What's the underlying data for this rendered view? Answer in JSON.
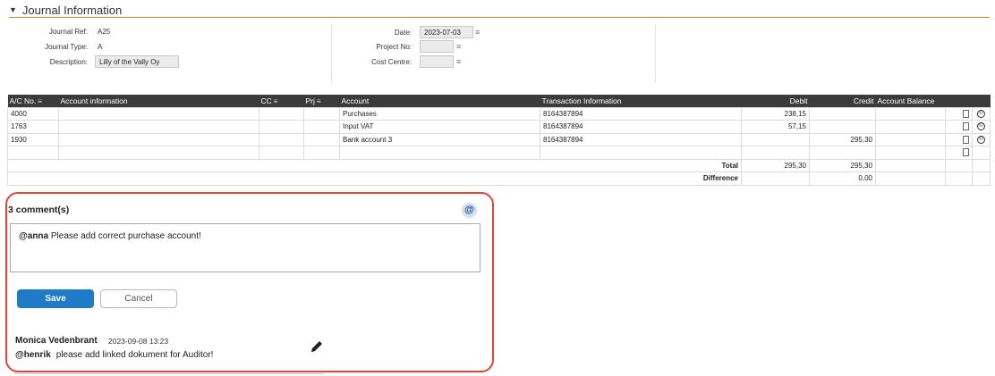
{
  "section": {
    "title": "Journal Information",
    "caret_icon": "caret-down-icon"
  },
  "journal": {
    "ref_label": "Journal Ref:",
    "ref_value": "A25",
    "type_label": "Journal Type:",
    "type_value": "A",
    "desc_label": "Description:",
    "desc_value": "Lilly of the Vally Oy",
    "date_label": "Date:",
    "date_value": "2023-07-03",
    "project_label": "Project No:",
    "project_value": "",
    "cost_label": "Cost Centre:",
    "cost_value": ""
  },
  "table": {
    "headers": {
      "ac_no": "A/C No.",
      "account_info": "Account information",
      "cc": "CC",
      "prj": "Prj",
      "account": "Account",
      "trans_info": "Transaction Information",
      "debit": "Debit",
      "credit": "Credit",
      "balance": "Account Balance"
    },
    "rows": [
      {
        "ac_no": "4000",
        "account": "Purchases",
        "trans": "8164387894",
        "debit": "238,15",
        "credit": ""
      },
      {
        "ac_no": "1763",
        "account": "Input VAT",
        "trans": "8164387894",
        "debit": "57,15",
        "credit": ""
      },
      {
        "ac_no": "1930",
        "account": "Bank account 3",
        "trans": "8164387894",
        "debit": "",
        "credit": "295,30"
      }
    ],
    "total_label": "Total",
    "total_debit": "295,30",
    "total_credit": "295,30",
    "difference_label": "Difference",
    "difference_credit": "0,00"
  },
  "comments": {
    "count_label": "3 comment(s)",
    "at_icon": "@",
    "draft_mention": "@anna",
    "draft_text": "Please add correct purchase account!",
    "save_label": "Save",
    "cancel_label": "Cancel",
    "items": [
      {
        "author": "Monica Vedenbrant",
        "date": "2023-09-08 13:23",
        "mention": "@henrik",
        "text": "please add linked dokument for Auditor!"
      }
    ]
  },
  "colors": {
    "accent": "#d8882a",
    "header_bg": "#3b3b3b",
    "save_btn": "#1f7bc8",
    "highlight": "#e24733"
  }
}
